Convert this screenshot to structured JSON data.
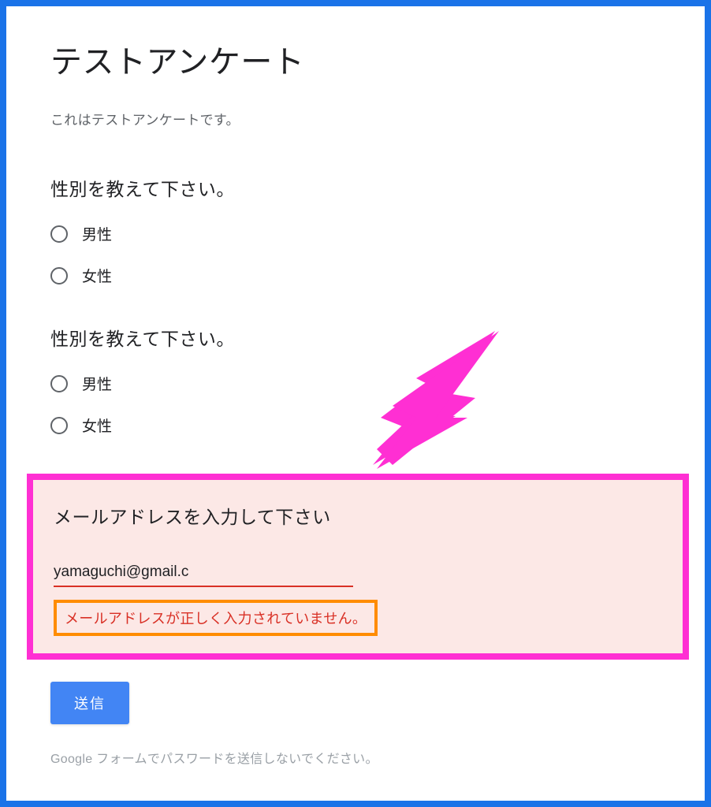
{
  "form": {
    "title": "テストアンケート",
    "description": "これはテストアンケートです。",
    "q1": {
      "title": "性別を教えて下さい。",
      "options": [
        "男性",
        "女性"
      ]
    },
    "q2": {
      "title": "性別を教えて下さい。",
      "options": [
        "男性",
        "女性"
      ]
    },
    "email": {
      "title": "メールアドレスを入力して下さい",
      "value": "yamaguchi@gmail.c",
      "error": "メールアドレスが正しく入力されていません。"
    },
    "submit_label": "送信",
    "footer": "Google フォームでパスワードを送信しないでください。"
  }
}
